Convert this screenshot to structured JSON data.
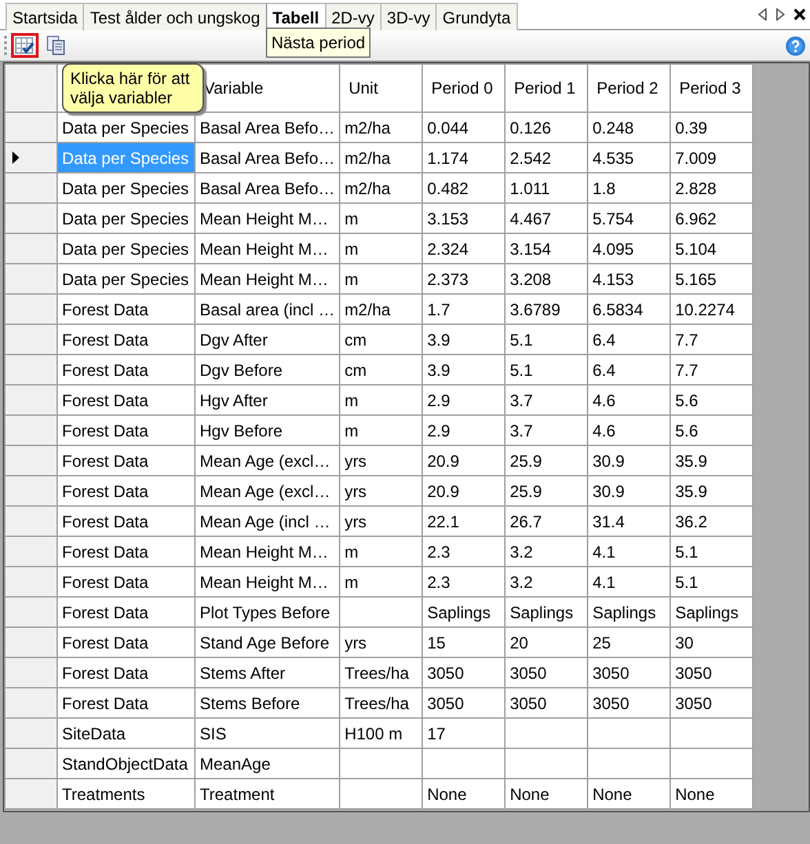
{
  "tabs": [
    {
      "label": "Startsida",
      "selected": false
    },
    {
      "label": "Test ålder och ungskog",
      "selected": false
    },
    {
      "label": "Tabell",
      "selected": true
    },
    {
      "label": "2D-vy",
      "selected": false
    },
    {
      "label": "3D-vy",
      "selected": false
    },
    {
      "label": "Grundyta",
      "selected": false
    }
  ],
  "toolbar": [
    {
      "kind": "choose-variables",
      "highlighted": true
    },
    {
      "kind": "copy",
      "highlighted": false
    }
  ],
  "tooltips": {
    "tab": "Nästa period",
    "callout": "Klicka här för att välja variabler"
  },
  "table": {
    "columns": [
      "",
      "Variable",
      "Unit",
      "Period 0",
      "Period 1",
      "Period 2",
      "Period 3"
    ],
    "rows": [
      {
        "selected": false,
        "cells": [
          "Data per Species",
          "Basal Area Befo…",
          "m2/ha",
          "0.044",
          "0.126",
          "0.248",
          "0.39"
        ]
      },
      {
        "selected": true,
        "cells": [
          "Data per Species",
          "Basal Area Befo…",
          "m2/ha",
          "1.174",
          "2.542",
          "4.535",
          "7.009"
        ]
      },
      {
        "selected": false,
        "cells": [
          "Data per Species",
          "Basal Area Befo…",
          "m2/ha",
          "0.482",
          "1.011",
          "1.8",
          "2.828"
        ]
      },
      {
        "selected": false,
        "cells": [
          "Data per Species",
          "Mean Height M…",
          "m",
          "3.153",
          "4.467",
          "5.754",
          "6.962"
        ]
      },
      {
        "selected": false,
        "cells": [
          "Data per Species",
          "Mean Height M…",
          "m",
          "2.324",
          "3.154",
          "4.095",
          "5.104"
        ]
      },
      {
        "selected": false,
        "cells": [
          "Data per Species",
          "Mean Height M…",
          "m",
          "2.373",
          "3.208",
          "4.153",
          "5.165"
        ]
      },
      {
        "selected": false,
        "cells": [
          "Forest Data",
          "Basal area (incl …",
          "m2/ha",
          "1.7",
          "3.6789",
          "6.5834",
          "10.2274"
        ]
      },
      {
        "selected": false,
        "cells": [
          "Forest Data",
          "Dgv After",
          "cm",
          "3.9",
          "5.1",
          "6.4",
          "7.7"
        ]
      },
      {
        "selected": false,
        "cells": [
          "Forest Data",
          "Dgv Before",
          "cm",
          "3.9",
          "5.1",
          "6.4",
          "7.7"
        ]
      },
      {
        "selected": false,
        "cells": [
          "Forest Data",
          "Hgv After",
          "m",
          "2.9",
          "3.7",
          "4.6",
          "5.6"
        ]
      },
      {
        "selected": false,
        "cells": [
          "Forest Data",
          "Hgv Before",
          "m",
          "2.9",
          "3.7",
          "4.6",
          "5.6"
        ]
      },
      {
        "selected": false,
        "cells": [
          "Forest Data",
          "Mean Age (excl…",
          "yrs",
          "20.9",
          "25.9",
          "30.9",
          "35.9"
        ]
      },
      {
        "selected": false,
        "cells": [
          "Forest Data",
          "Mean Age (excl…",
          "yrs",
          "20.9",
          "25.9",
          "30.9",
          "35.9"
        ]
      },
      {
        "selected": false,
        "cells": [
          "Forest Data",
          "Mean Age (incl …",
          "yrs",
          "22.1",
          "26.7",
          "31.4",
          "36.2"
        ]
      },
      {
        "selected": false,
        "cells": [
          "Forest Data",
          "Mean Height M…",
          "m",
          "2.3",
          "3.2",
          "4.1",
          "5.1"
        ]
      },
      {
        "selected": false,
        "cells": [
          "Forest Data",
          "Mean Height M…",
          "m",
          "2.3",
          "3.2",
          "4.1",
          "5.1"
        ]
      },
      {
        "selected": false,
        "cells": [
          "Forest Data",
          "Plot Types Before",
          null,
          "Saplings",
          "Saplings",
          "Saplings",
          "Saplings"
        ]
      },
      {
        "selected": false,
        "cells": [
          "Forest Data",
          "Stand Age Before",
          "yrs",
          "15",
          "20",
          "25",
          "30"
        ]
      },
      {
        "selected": false,
        "cells": [
          "Forest Data",
          "Stems After",
          "Trees/ha",
          "3050",
          "3050",
          "3050",
          "3050"
        ]
      },
      {
        "selected": false,
        "cells": [
          "Forest Data",
          "Stems Before",
          "Trees/ha",
          "3050",
          "3050",
          "3050",
          "3050"
        ]
      },
      {
        "selected": false,
        "cells": [
          "SiteData",
          "SIS",
          "H100 m",
          "17",
          null,
          null,
          null
        ]
      },
      {
        "selected": false,
        "cells": [
          "StandObjectData",
          "MeanAge",
          null,
          null,
          null,
          null,
          null
        ]
      },
      {
        "selected": false,
        "cells": [
          "Treatments",
          "Treatment",
          null,
          "None",
          "None",
          "None",
          "None"
        ]
      }
    ]
  }
}
